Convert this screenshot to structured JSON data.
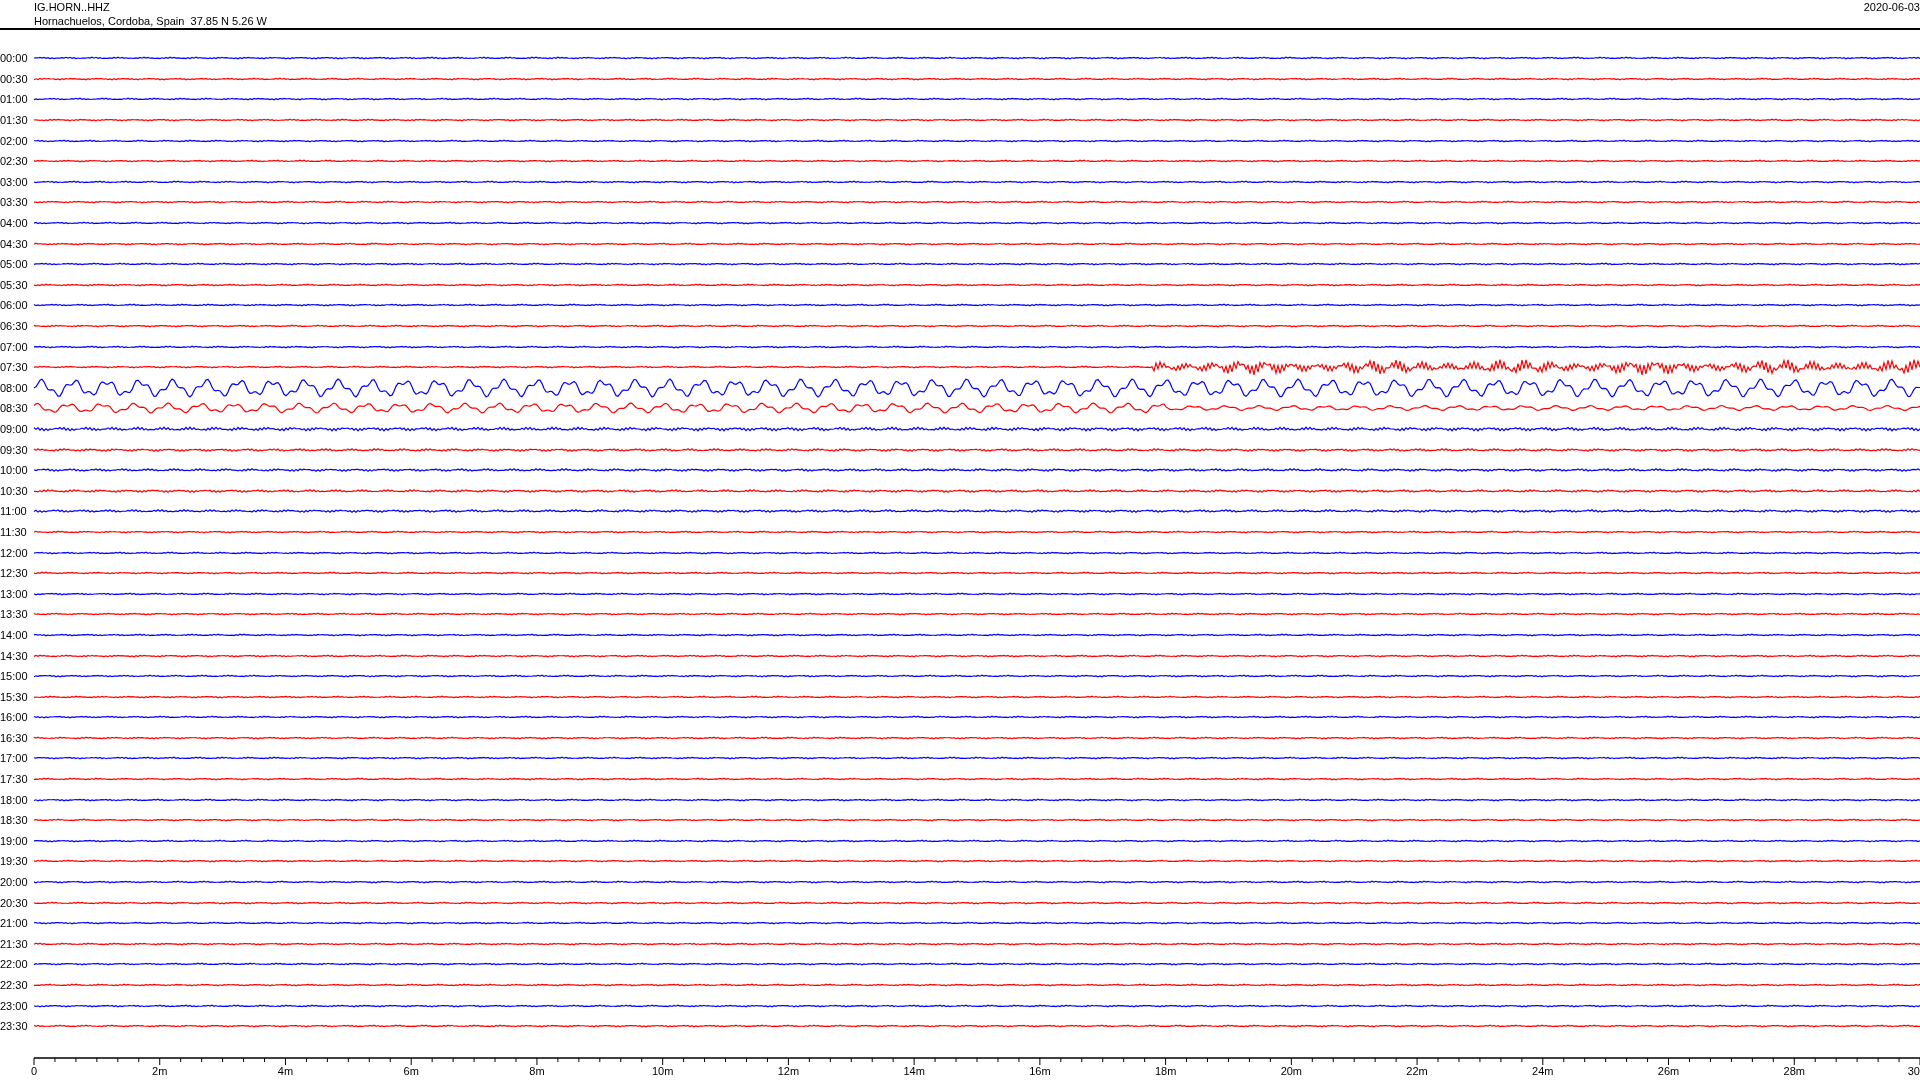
{
  "header": {
    "station": "IG.HORN..HHZ",
    "location": "Hornachuelos, Cordoba, Spain  37.85 N 5.26 W",
    "date": "2020-06-03"
  },
  "traces": [
    {
      "label": "00:00",
      "color": "#0000ff"
    },
    {
      "label": "00:30",
      "color": "#ff0000"
    },
    {
      "label": "01:00",
      "color": "#0000ff"
    },
    {
      "label": "01:30",
      "color": "#ff0000"
    },
    {
      "label": "02:00",
      "color": "#0000ff"
    },
    {
      "label": "02:30",
      "color": "#ff0000"
    },
    {
      "label": "03:00",
      "color": "#0000ff"
    },
    {
      "label": "03:30",
      "color": "#ff0000"
    },
    {
      "label": "04:00",
      "color": "#0000ff"
    },
    {
      "label": "04:30",
      "color": "#ff0000"
    },
    {
      "label": "05:00",
      "color": "#0000ff"
    },
    {
      "label": "05:30",
      "color": "#ff0000"
    },
    {
      "label": "06:00",
      "color": "#0000ff"
    },
    {
      "label": "06:30",
      "color": "#ff0000"
    },
    {
      "label": "07:00",
      "color": "#0000ff"
    },
    {
      "label": "07:30",
      "color": "#ff0000"
    },
    {
      "label": "08:00",
      "color": "#0000ff"
    },
    {
      "label": "08:30",
      "color": "#ff0000"
    },
    {
      "label": "09:00",
      "color": "#0000ff"
    },
    {
      "label": "09:30",
      "color": "#ff0000"
    },
    {
      "label": "10:00",
      "color": "#0000ff"
    },
    {
      "label": "10:30",
      "color": "#ff0000"
    },
    {
      "label": "11:00",
      "color": "#0000ff"
    },
    {
      "label": "11:30",
      "color": "#ff0000"
    },
    {
      "label": "12:00",
      "color": "#0000ff"
    },
    {
      "label": "12:30",
      "color": "#ff0000"
    },
    {
      "label": "13:00",
      "color": "#0000ff"
    },
    {
      "label": "13:30",
      "color": "#ff0000"
    },
    {
      "label": "14:00",
      "color": "#0000ff"
    },
    {
      "label": "14:30",
      "color": "#ff0000"
    },
    {
      "label": "15:00",
      "color": "#0000ff"
    },
    {
      "label": "15:30",
      "color": "#ff0000"
    },
    {
      "label": "16:00",
      "color": "#0000ff"
    },
    {
      "label": "16:30",
      "color": "#ff0000"
    },
    {
      "label": "17:00",
      "color": "#0000ff"
    },
    {
      "label": "17:30",
      "color": "#ff0000"
    },
    {
      "label": "18:00",
      "color": "#0000ff"
    },
    {
      "label": "18:30",
      "color": "#ff0000"
    },
    {
      "label": "19:00",
      "color": "#0000ff"
    },
    {
      "label": "19:30",
      "color": "#ff0000"
    },
    {
      "label": "20:00",
      "color": "#0000ff"
    },
    {
      "label": "20:30",
      "color": "#ff0000"
    },
    {
      "label": "21:00",
      "color": "#0000ff"
    },
    {
      "label": "21:30",
      "color": "#ff0000"
    },
    {
      "label": "22:00",
      "color": "#0000ff"
    },
    {
      "label": "22:30",
      "color": "#ff0000"
    },
    {
      "label": "23:00",
      "color": "#0000ff"
    },
    {
      "label": "23:30",
      "color": "#ff0000"
    }
  ],
  "x_axis": {
    "ticks": [
      "0",
      "2m",
      "4m",
      "6m",
      "8m",
      "10m",
      "12m",
      "14m",
      "16m",
      "18m",
      "20m",
      "22m",
      "24m",
      "26m",
      "28m",
      "30"
    ]
  }
}
